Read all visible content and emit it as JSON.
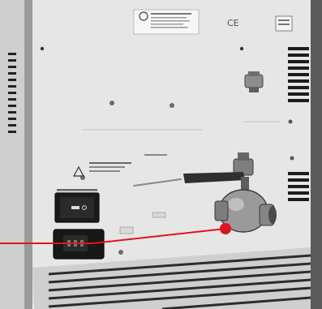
{
  "photo": {
    "colors": {
      "panel": "#e6e6e6",
      "panel_shadow": "#bdbdbd",
      "edge_dark": "#3a3a3a",
      "brass": "#8a8a8a",
      "handle": "#2e2e2e",
      "callout": "#e0141e"
    }
  },
  "callout": {
    "target": "ball-valve",
    "target_fraction": [
      0.7,
      0.74
    ]
  }
}
